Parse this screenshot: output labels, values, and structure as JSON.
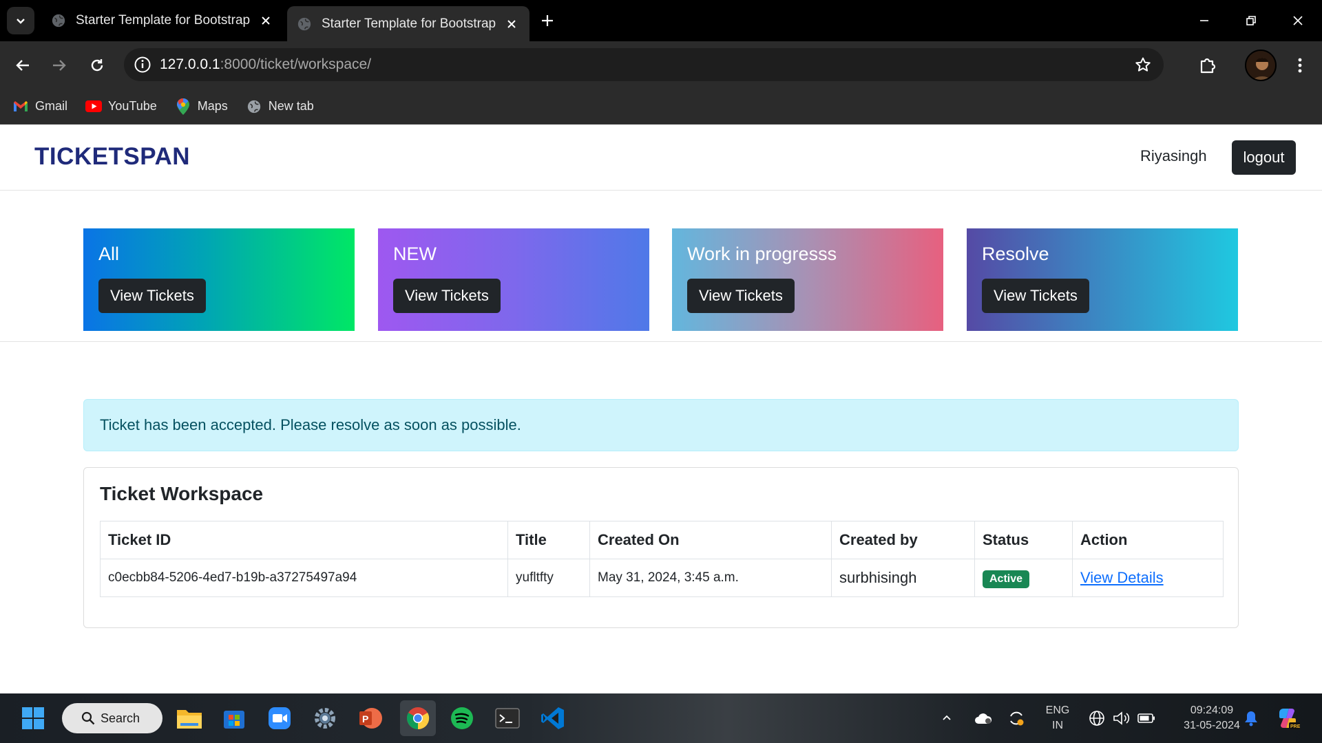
{
  "browser": {
    "tabs": [
      {
        "title": "Starter Template for Bootstrap",
        "active": false
      },
      {
        "title": "Starter Template for Bootstrap",
        "active": true
      }
    ],
    "url_host": "127.0.0.1",
    "url_path": ":8000/ticket/workspace/",
    "bookmarks": [
      {
        "label": "Gmail",
        "icon": "gmail-icon"
      },
      {
        "label": "YouTube",
        "icon": "youtube-icon"
      },
      {
        "label": "Maps",
        "icon": "maps-icon"
      },
      {
        "label": "New tab",
        "icon": "globe-icon"
      }
    ]
  },
  "site": {
    "brand": "TICKETSPAN",
    "username": "Riyasingh",
    "logout_label": "logout"
  },
  "cards": [
    {
      "title": "All",
      "button": "View Tickets"
    },
    {
      "title": "NEW",
      "button": "View Tickets"
    },
    {
      "title": "Work in progresss",
      "button": "View Tickets"
    },
    {
      "title": "Resolve",
      "button": "View Tickets"
    }
  ],
  "alert": {
    "message": "Ticket has been accepted. Please resolve as soon as possible."
  },
  "workspace": {
    "title": "Ticket Workspace",
    "columns": [
      "Ticket ID",
      "Title",
      "Created On",
      "Created by",
      "Status",
      "Action"
    ],
    "rows": [
      {
        "ticket_id": "c0ecbb84-5206-4ed7-b19b-a37275497a94",
        "title": "yufltfty",
        "created_on": "May 31, 2024, 3:45 a.m.",
        "created_by": "surbhisingh",
        "status": "Active",
        "action": "View Details"
      }
    ]
  },
  "taskbar": {
    "search_label": "Search",
    "lang_top": "ENG",
    "lang_bottom": "IN",
    "time": "09:24:09",
    "date": "31-05-2024"
  },
  "colors": {
    "brand": "#1f2a7a",
    "status_active": "#198754",
    "alert_bg": "#cff4fc"
  }
}
